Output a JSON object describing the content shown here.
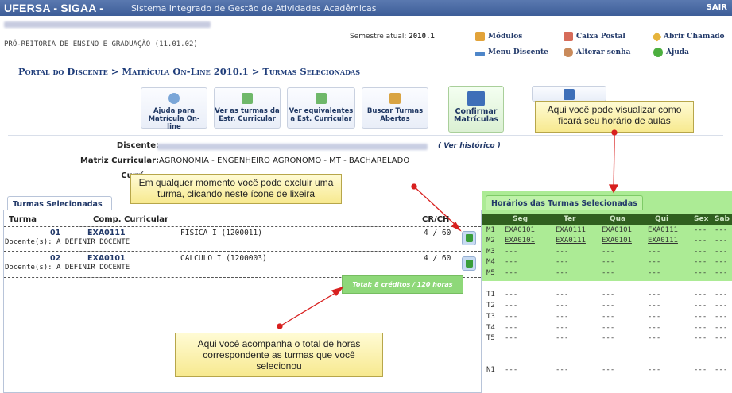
{
  "header": {
    "app_name": "UFERSA - SIGAA -",
    "system_name": "Sistema Integrado de Gestão de Atividades Acadêmicas",
    "exit_label": "SAIR"
  },
  "info_bar": {
    "unit": "PRÓ-REITORIA DE ENSINO E GRADUAÇÃO (11.01.02)",
    "semester_label": "Semestre atual:",
    "semester_value": "2010.1"
  },
  "toolbar": {
    "modulos": "Módulos",
    "caixa_postal": "Caixa Postal",
    "abrir_chamado": "Abrir Chamado",
    "menu_discente": "Menu Discente",
    "alterar_senha": "Alterar senha",
    "ajuda": "Ajuda"
  },
  "breadcrumb": "Portal do Discente > Matrícula On-Line 2010.1 > Turmas Selecionadas",
  "actions": [
    {
      "line1": "Ajuda para",
      "line2": "Matrícula On-line"
    },
    {
      "line1": "Ver as turmas da",
      "line2": "Estr. Curricular"
    },
    {
      "line1": "Ver equivalentes",
      "line2": "a Est. Curricular"
    },
    {
      "line1": "Buscar Turmas",
      "line2": "Abertas"
    },
    {
      "line1": "Confirmar",
      "line2": "Matrículas"
    }
  ],
  "discente": {
    "discente_label": "Discente:",
    "ver_historico": "( Ver histórico )",
    "matriz_label": "Matriz Curricular:",
    "matriz_value": "AGRONOMIA - ENGENHEIRO AGRONOMO - MT - BACHARELADO",
    "curriculo_label": "Currí"
  },
  "turmas": {
    "tab_label": "Turmas Selecionadas",
    "col_turma": "Turma",
    "col_comp": "Comp. Curricular",
    "col_crch": "CR/CH",
    "rows": [
      {
        "turma": "01",
        "code": "EXA0111",
        "name": "FISICA I (1200011)",
        "crch": "4 / 60",
        "docente": "Docente(s): A DEFINIR DOCENTE"
      },
      {
        "turma": "02",
        "code": "EXA0101",
        "name": "CALCULO I (1200003)",
        "crch": "4 / 60",
        "docente": "Docente(s): A DEFINIR DOCENTE"
      }
    ],
    "total": "Total: 8 créditos / 120 horas"
  },
  "schedule": {
    "tab_label": "Horários das Turmas Selecionadas",
    "days": [
      "Seg",
      "Ter",
      "Qua",
      "Qui",
      "Sex",
      "Sab"
    ],
    "rows": [
      {
        "slot": "M1",
        "cells": [
          "EXA0101",
          "EXA0111",
          "EXA0101",
          "EXA0111",
          "---",
          "---"
        ]
      },
      {
        "slot": "M2",
        "cells": [
          "EXA0101",
          "EXA0111",
          "EXA0101",
          "EXA0111",
          "---",
          "---"
        ]
      },
      {
        "slot": "M3",
        "cells": [
          "---",
          "---",
          "---",
          "---",
          "---",
          "---"
        ]
      },
      {
        "slot": "M4",
        "cells": [
          "---",
          "---",
          "---",
          "---",
          "---",
          "---"
        ]
      },
      {
        "slot": "M5",
        "cells": [
          "---",
          "---",
          "---",
          "---",
          "---",
          "---"
        ]
      },
      {
        "slot": "T1",
        "cells": [
          "---",
          "---",
          "---",
          "---",
          "---",
          "---"
        ]
      },
      {
        "slot": "T2",
        "cells": [
          "---",
          "---",
          "---",
          "---",
          "---",
          "---"
        ]
      },
      {
        "slot": "T3",
        "cells": [
          "---",
          "---",
          "---",
          "---",
          "---",
          "---"
        ]
      },
      {
        "slot": "T4",
        "cells": [
          "---",
          "---",
          "---",
          "---",
          "---",
          "---"
        ]
      },
      {
        "slot": "T5",
        "cells": [
          "---",
          "---",
          "---",
          "---",
          "---",
          "---"
        ]
      },
      {
        "slot": "N1",
        "cells": [
          "---",
          "---",
          "---",
          "---",
          "---",
          "---"
        ]
      }
    ]
  },
  "callouts": {
    "schedule": "Aqui você pode visualizar como ficará seu horário de aulas",
    "trash": "Em qualquer momento você pode excluir uma turma, clicando neste ícone de lixeira",
    "total": "Aqui você acompanha o total de horas correspondente as turmas que você selecionou"
  }
}
